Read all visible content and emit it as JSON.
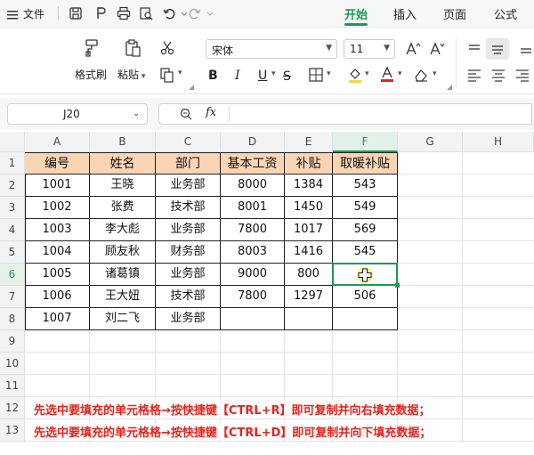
{
  "titlebar": {
    "file_menu": "文件",
    "tabs": [
      {
        "label": "开始",
        "active": true
      },
      {
        "label": "插入",
        "active": false
      },
      {
        "label": "页面",
        "active": false
      },
      {
        "label": "公式",
        "active": false
      }
    ]
  },
  "ribbon": {
    "format_painter": "格式刷",
    "paste": "粘贴",
    "font_name": "宋体",
    "font_size": "11"
  },
  "formula_bar": {
    "name_box": "J20",
    "fx": "fx",
    "content": ""
  },
  "sheet": {
    "columns": [
      "A",
      "B",
      "C",
      "D",
      "E",
      "F",
      "G",
      "H"
    ],
    "rows": [
      "1",
      "2",
      "3",
      "4",
      "5",
      "6",
      "7",
      "8",
      "9",
      "10",
      "11",
      "12",
      "13"
    ],
    "selected_column": "F",
    "selected_row": "6",
    "table": {
      "headers": [
        "编号",
        "姓名",
        "部门",
        "基本工资",
        "补贴",
        "取暖补贴"
      ],
      "data": [
        [
          "1001",
          "王晓",
          "业务部",
          "8000",
          "1384",
          "543"
        ],
        [
          "1002",
          "张费",
          "技术部",
          "8001",
          "1450",
          "549"
        ],
        [
          "1003",
          "李大彪",
          "业务部",
          "7800",
          "1017",
          "569"
        ],
        [
          "1004",
          "顾友秋",
          "财务部",
          "8003",
          "1416",
          "545"
        ],
        [
          "1005",
          "诸葛镇",
          "业务部",
          "9000",
          "800",
          ""
        ],
        [
          "1006",
          "王大妞",
          "技术部",
          "7800",
          "1297",
          "506"
        ],
        [
          "1007",
          "刘二飞",
          "业务部",
          "",
          "",
          ""
        ]
      ]
    },
    "notes": [
      "先选中要填充的单元格格→按快捷键【CTRL+R】即可复制并向右填充数据；",
      "先选中要填充的单元格格→按快捷键【CTRL+D】即可复制并向下填充数据；"
    ]
  },
  "colors": {
    "accent": "#1a9a55",
    "header_fill": "#fbd4b4",
    "note_text": "#e8221b",
    "cursor": "#f5d742"
  }
}
